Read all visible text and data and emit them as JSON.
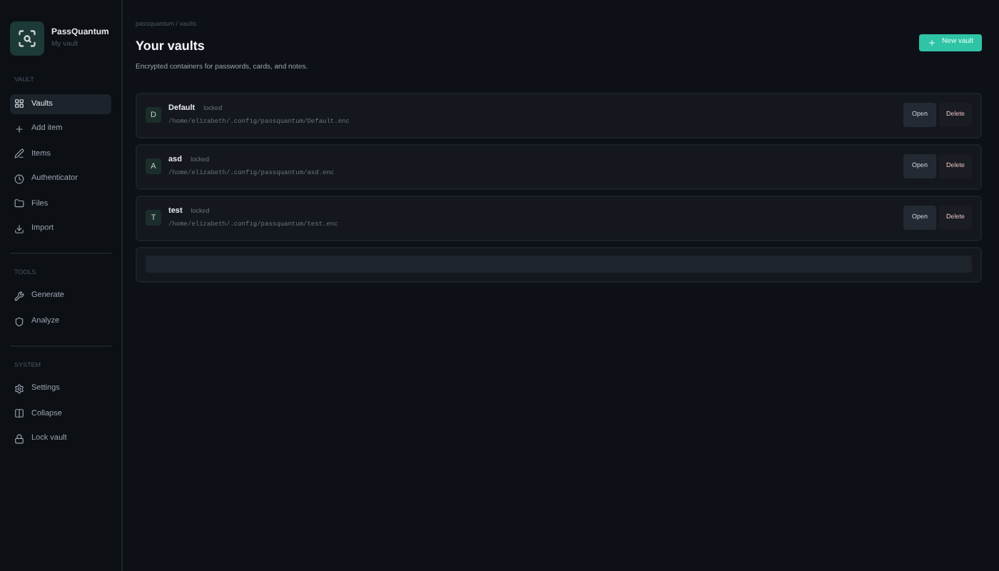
{
  "app": {
    "name": "PassQuantum",
    "subtitle": "My vault"
  },
  "sidebar": {
    "sections": [
      {
        "heading": "VAULT",
        "items": [
          {
            "label": "Vaults",
            "selected": true
          },
          {
            "label": "Add item",
            "selected": false
          },
          {
            "label": "Items",
            "selected": false
          },
          {
            "label": "Authenticator",
            "selected": false
          },
          {
            "label": "Files",
            "selected": false
          },
          {
            "label": "Import",
            "selected": false
          }
        ]
      },
      {
        "heading": "TOOLS",
        "items": [
          {
            "label": "Generate",
            "selected": false
          },
          {
            "label": "Analyze",
            "selected": false
          }
        ]
      },
      {
        "heading": "SYSTEM",
        "items": [
          {
            "label": "Settings",
            "selected": false
          },
          {
            "label": "Collapse",
            "selected": false
          },
          {
            "label": "Lock vault",
            "selected": false
          }
        ]
      }
    ]
  },
  "breadcrumb": "passquantum / vaults",
  "title": "Your vaults",
  "description": "Encrypted containers for passwords, cards, and notes.",
  "new_button": "New vault",
  "vaults": [
    {
      "initial": "D",
      "name": "Default",
      "status": "locked",
      "path": "/home/elizabeth/.config/passquantum/Default.enc",
      "open": "Open",
      "delete": "Delete"
    },
    {
      "initial": "A",
      "name": "asd",
      "status": "locked",
      "path": "/home/elizabeth/.config/passquantum/asd.enc",
      "open": "Open",
      "delete": "Delete"
    },
    {
      "initial": "T",
      "name": "test",
      "status": "locked",
      "path": "/home/elizabeth/.config/passquantum/test.enc",
      "open": "Open",
      "delete": "Delete"
    }
  ]
}
